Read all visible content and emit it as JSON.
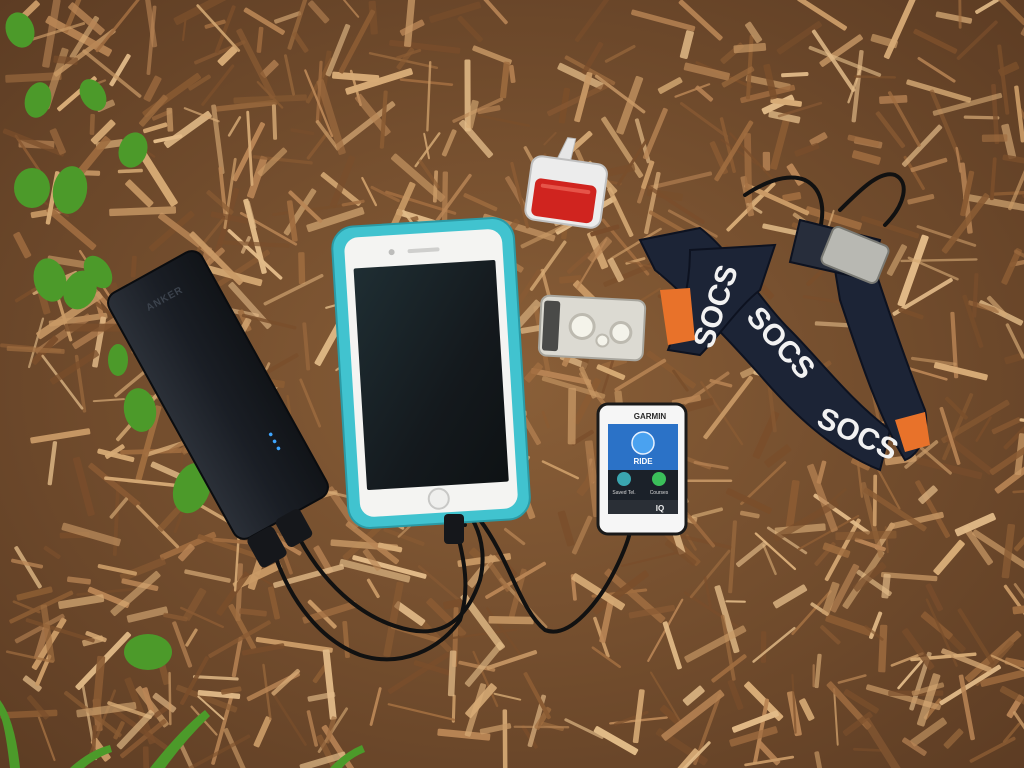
{
  "scene": {
    "description_items": [
      "power-bank",
      "smartphone",
      "cycling-computer",
      "rear-bike-light",
      "headlamp",
      "headlamp-strap",
      "charging-cables"
    ]
  },
  "power_bank": {
    "brand_text": "ANKER"
  },
  "headlamp_strap": {
    "print_1": "SOCS",
    "print_2": "SOCS",
    "print_3": "SOCS"
  },
  "bike_computer": {
    "brand": "GARMIN",
    "menu_title": "RIDE",
    "left_button": "Saved Tel.",
    "right_button": "Courses",
    "iq_label": "IQ"
  },
  "colors": {
    "mulch": "#7a5230",
    "phone_case": "#41c3cf",
    "power_bank": "#1a1e25",
    "strap": "#1c2436",
    "strap_print": "#e8722a",
    "taillight_red": "#d0241f",
    "leaf_green": "#4c9a2a"
  }
}
